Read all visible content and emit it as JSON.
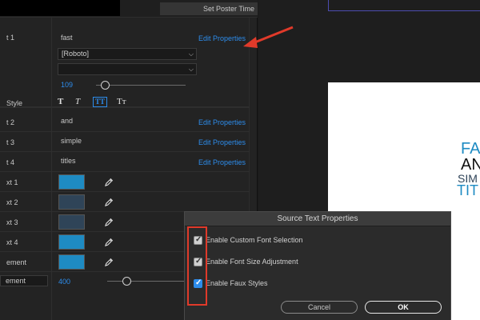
{
  "header": {
    "poster_button": "Set Poster Time"
  },
  "rows": {
    "text1": {
      "label": "t 1",
      "value": "fast",
      "edit": "Edit Properties"
    },
    "font": {
      "value": "[Roboto]"
    },
    "style_dropdown": {
      "value": ""
    },
    "size": {
      "value": "109",
      "fraction": 0.1
    },
    "style": {
      "label": "Style",
      "buttons": [
        "T",
        "T",
        "TT",
        "Tт"
      ]
    },
    "text2": {
      "label": "t 2",
      "value": "and",
      "edit": "Edit Properties"
    },
    "text3": {
      "label": "t 3",
      "value": "simple",
      "edit": "Edit Properties"
    },
    "text4": {
      "label": "t 4",
      "value": "titles",
      "edit": "Edit Properties"
    },
    "colors": [
      {
        "label": "xt 1",
        "color": "#1e8bc3"
      },
      {
        "label": "xt 2",
        "color": "#2f4458"
      },
      {
        "label": "xt 3",
        "color": "#2f4458"
      },
      {
        "label": "xt 4",
        "color": "#1e8bc3"
      },
      {
        "label": "ement",
        "color": "#1e8bc3"
      }
    ],
    "element": {
      "label": "ement",
      "value": "400",
      "fraction": 0.25
    }
  },
  "composition": {
    "lines": [
      {
        "text": "FA",
        "color": "#1e8bc3"
      },
      {
        "text": "AN",
        "color": "#111111"
      },
      {
        "text": "SIM",
        "color": "#2f4458"
      },
      {
        "text": "TIT",
        "color": "#1e8bc3"
      }
    ]
  },
  "dialog": {
    "title": "Source Text Properties",
    "options": [
      {
        "label": "Enable Custom Font Selection",
        "checked": true,
        "style": "gray"
      },
      {
        "label": "Enable Font Size Adjustment",
        "checked": true,
        "style": "gray"
      },
      {
        "label": "Enable Faux Styles",
        "checked": true,
        "style": "blue"
      }
    ],
    "cancel": "Cancel",
    "ok": "OK"
  },
  "colors": {
    "accent": "#2d8ceb",
    "annotation": "#e03a2a"
  }
}
